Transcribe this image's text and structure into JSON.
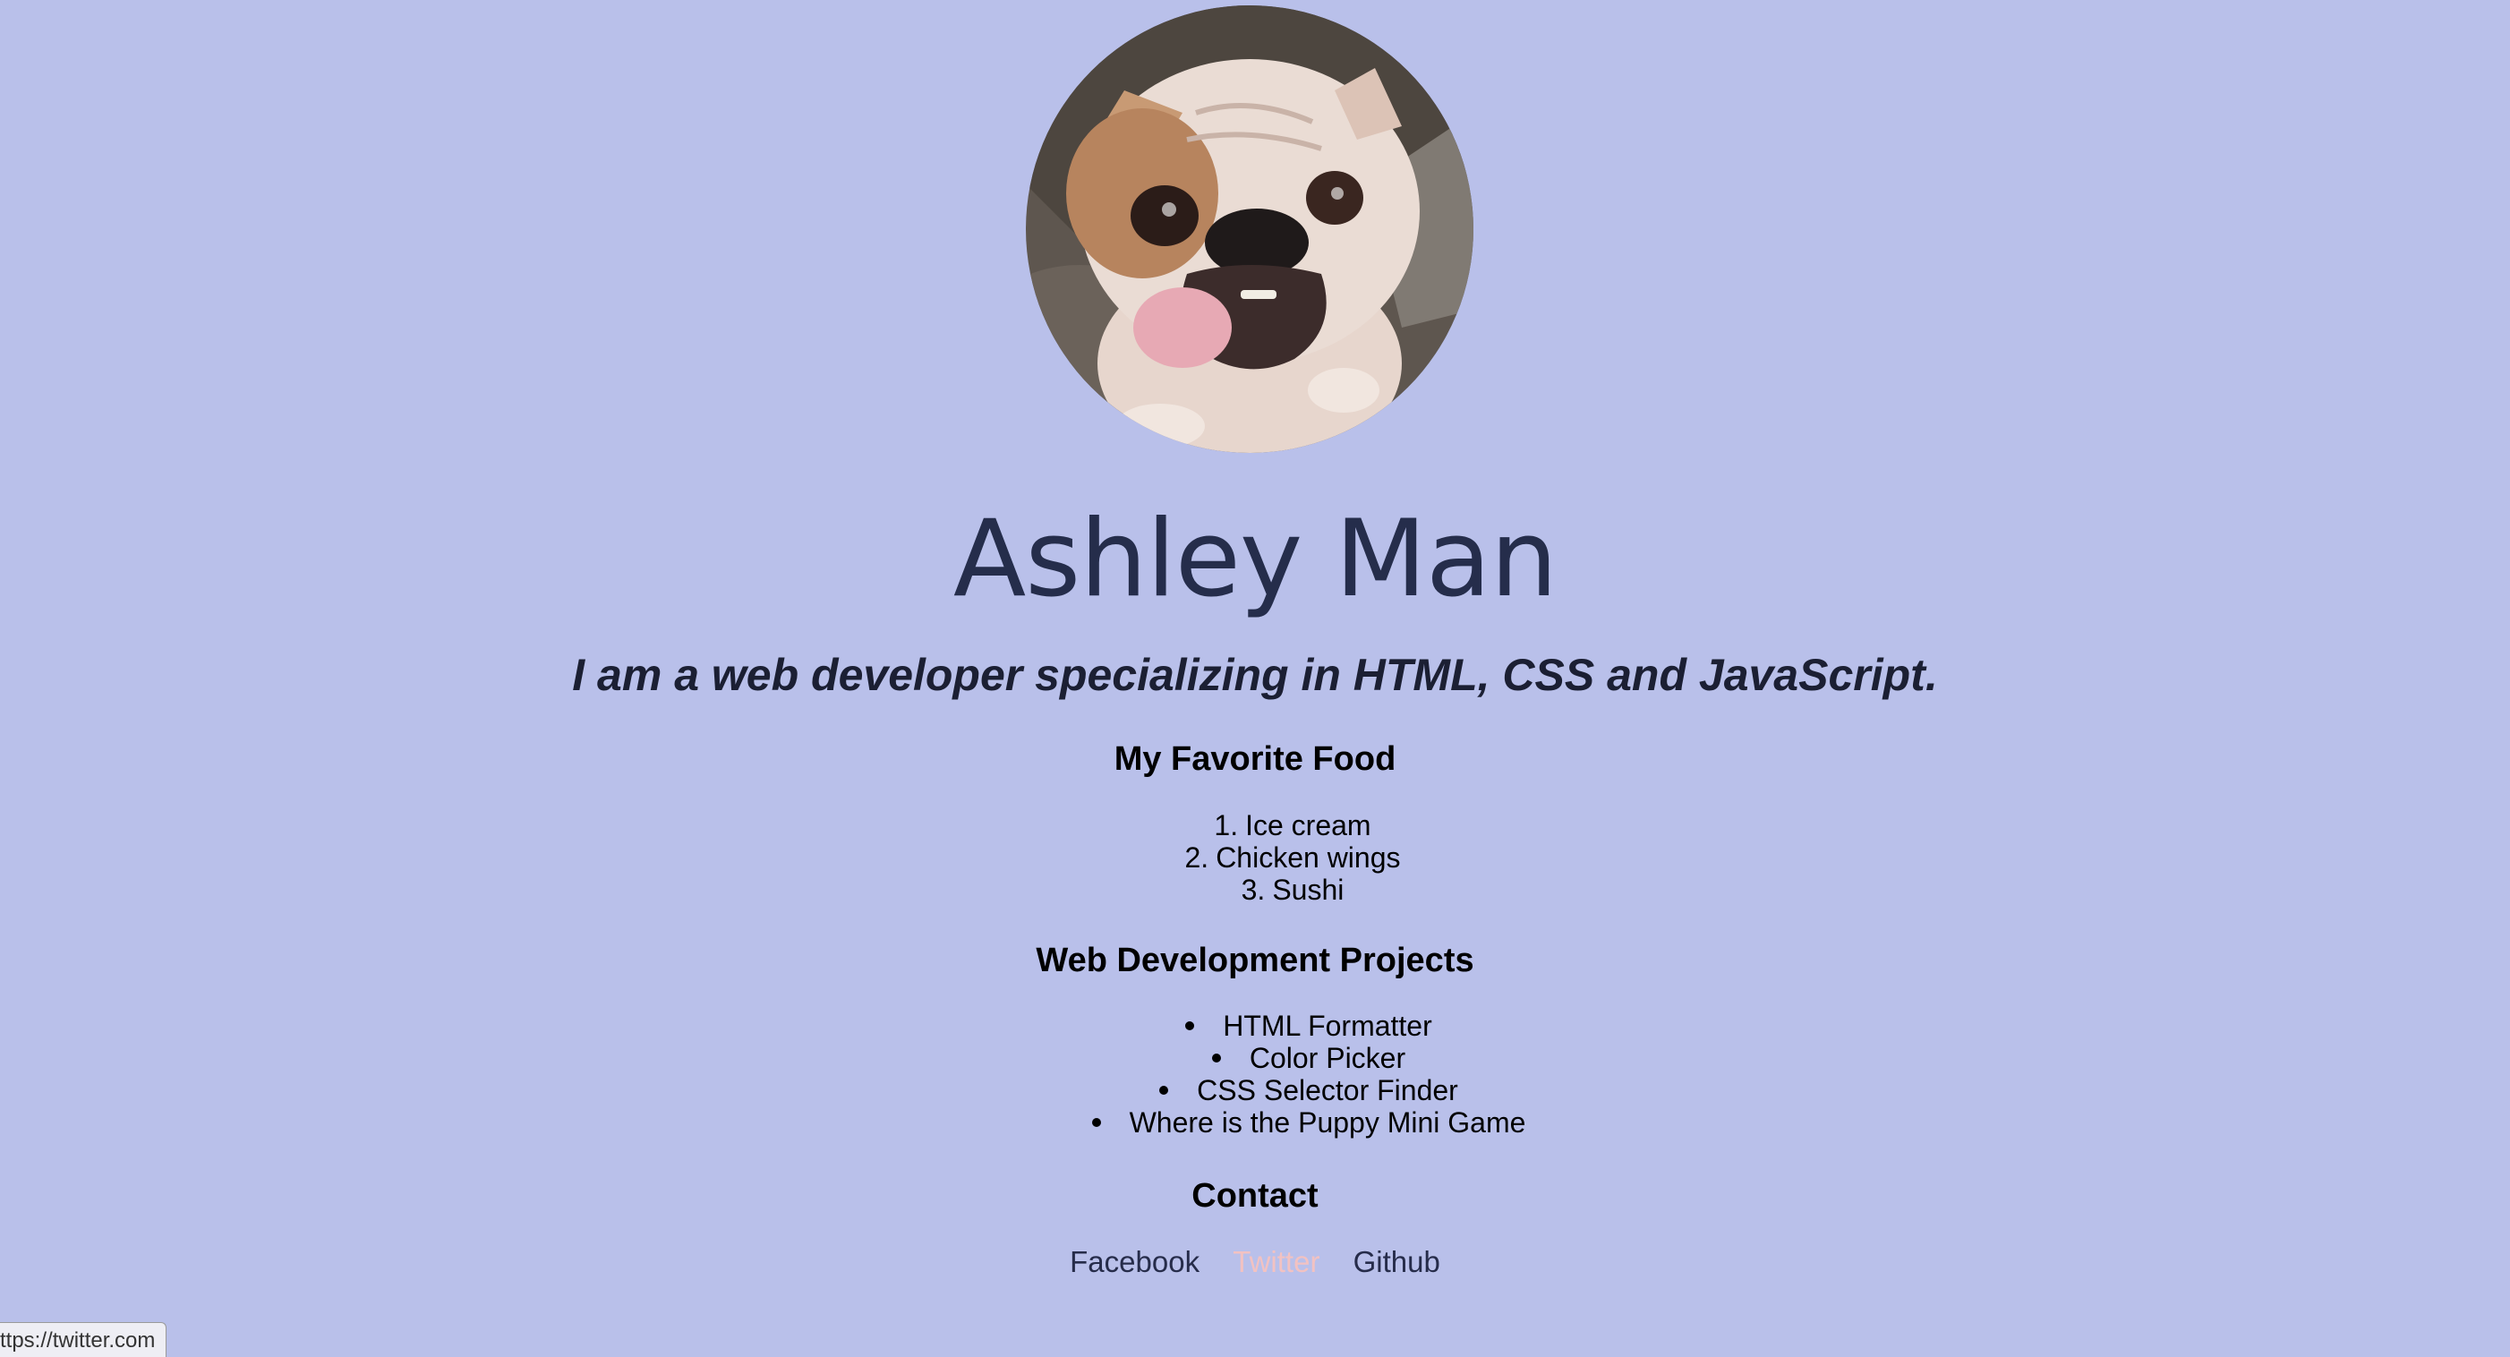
{
  "profile": {
    "image_alt": "bulldog photo",
    "name": "Ashley Man",
    "tagline": "I am a web developer specializing in HTML, CSS and JavaScript."
  },
  "food": {
    "title": "My Favorite Food",
    "items": [
      {
        "num": "1.",
        "label": "Ice cream"
      },
      {
        "num": "2.",
        "label": "Chicken wings"
      },
      {
        "num": "3.",
        "label": "Sushi"
      }
    ]
  },
  "projects": {
    "title": "Web Development Projects",
    "items": [
      {
        "label": "HTML Formatter"
      },
      {
        "label": "Color Picker"
      },
      {
        "label": "CSS Selector Finder"
      },
      {
        "label": "Where is the Puppy Mini Game"
      }
    ]
  },
  "contact": {
    "title": "Contact",
    "links": [
      {
        "label": "Facebook"
      },
      {
        "label": "Twitter"
      },
      {
        "label": "Github"
      }
    ]
  },
  "status_bar": {
    "url": "ttps://twitter.com"
  },
  "colors": {
    "background": "#b9c0ea",
    "name_color": "#252d4b",
    "link_color": "#262c4a",
    "link_hover_color": "#f2c2c2"
  }
}
